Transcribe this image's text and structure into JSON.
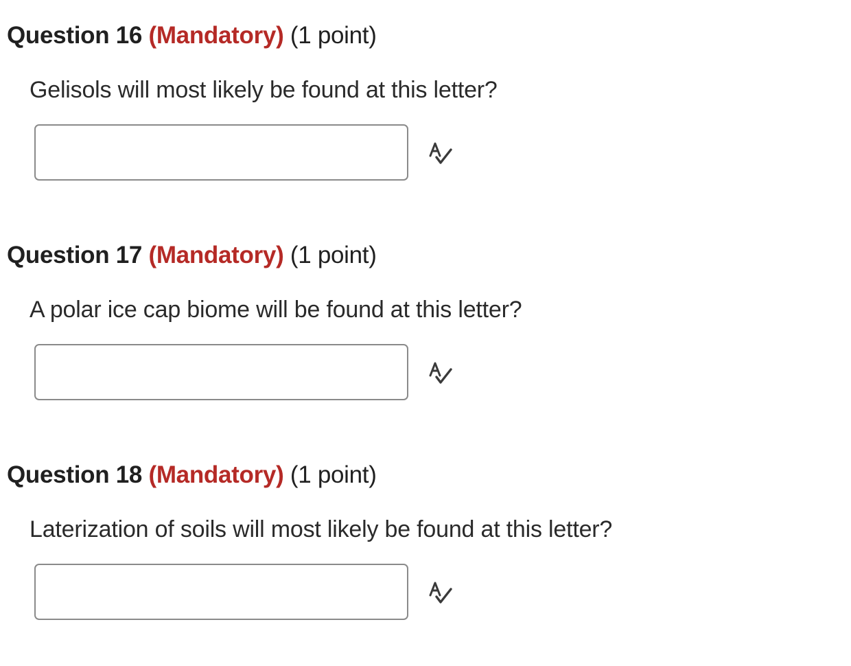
{
  "colors": {
    "accent": "#b52a26",
    "heading": "#202020",
    "text": "#2a2a2a",
    "input_border": "#8a8a8a"
  },
  "questions": [
    {
      "title": "Question 16",
      "mandatory": "(Mandatory)",
      "points": "(1 point)",
      "prompt": "Gelisols will most likely be found at this letter?",
      "answer_value": "",
      "icon": "spell-check-icon"
    },
    {
      "title": "Question 17",
      "mandatory": "(Mandatory)",
      "points": "(1 point)",
      "prompt": "A polar ice cap biome will be found at this letter?",
      "answer_value": "",
      "icon": "spell-check-icon"
    },
    {
      "title": "Question 18",
      "mandatory": "(Mandatory)",
      "points": "(1 point)",
      "prompt": "Laterization of soils will most likely be found at this letter?",
      "answer_value": "",
      "icon": "spell-check-icon"
    }
  ]
}
